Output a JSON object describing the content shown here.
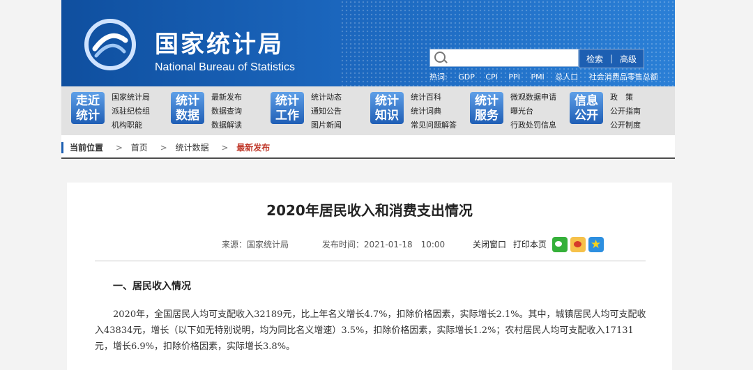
{
  "header": {
    "title_cn": "国家统计局",
    "title_en": "National Bureau of Statistics",
    "search": {
      "placeholder": "",
      "btn_search": "检索",
      "separator": "|",
      "btn_advanced": "高级"
    },
    "hot_label": "热词:",
    "hot_terms": [
      "GDP",
      "CPI",
      "PPI",
      "PMI",
      "总人口",
      "社会消费品零售总额"
    ]
  },
  "nav": [
    {
      "badge": [
        "走近",
        "统计"
      ],
      "links": [
        "国家统计局",
        "派驻纪检组",
        "机构职能"
      ]
    },
    {
      "badge": [
        "统计",
        "数据"
      ],
      "links": [
        "最新发布",
        "数据查询",
        "数据解读"
      ]
    },
    {
      "badge": [
        "统计",
        "工作"
      ],
      "links": [
        "统计动态",
        "通知公告",
        "图片新闻"
      ]
    },
    {
      "badge": [
        "统计",
        "知识"
      ],
      "links": [
        "统计百科",
        "统计词典",
        "常见问题解答"
      ]
    },
    {
      "badge": [
        "统计",
        "服务"
      ],
      "links": [
        "微观数据申请",
        "曝光台",
        "行政处罚信息"
      ]
    },
    {
      "badge": [
        "信息",
        "公开"
      ],
      "links": [
        "政　策",
        "公开指南",
        "公开制度"
      ]
    }
  ],
  "breadcrumb": {
    "items": [
      "当前位置",
      "首页",
      "统计数据",
      "最新发布"
    ],
    "arrow": ">"
  },
  "article": {
    "title": "2020年居民收入和消费支出情况",
    "source": "来源：国家统计局",
    "publish_time": "发布时间：2021-01-18　10:00",
    "close_window": "关闭窗口",
    "print_page": "打印本页",
    "section_heading": "一、居民收入情况",
    "paragraph": "2020年，全国居民人均可支配收入32189元，比上年名义增长4.7%，扣除价格因素，实际增长2.1%。其中，城镇居民人均可支配收入43834元，增长（以下如无特别说明，均为同比名义增速）3.5%，扣除价格因素，实际增长1.2%；农村居民人均可支配收入17131元，增长6.9%，扣除价格因素，实际增长3.8%。"
  }
}
